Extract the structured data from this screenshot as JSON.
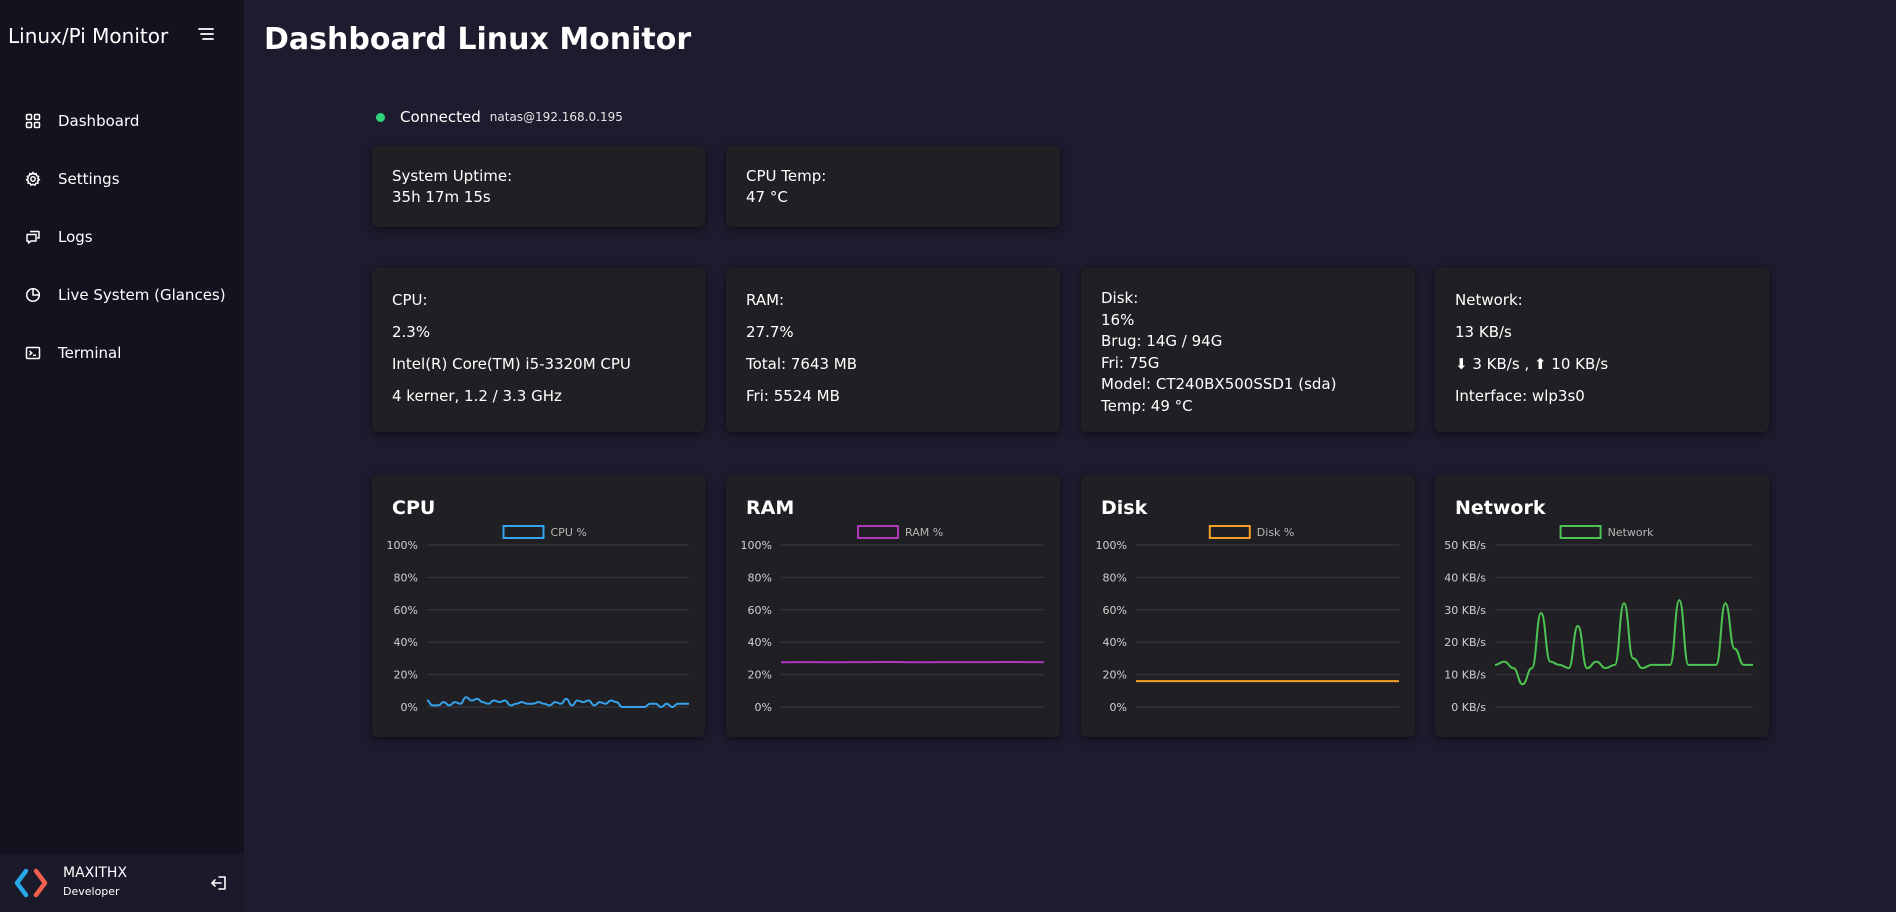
{
  "sidebar": {
    "brand": "Linux/Pi Monitor",
    "items": [
      {
        "label": "Dashboard",
        "icon": "grid-icon"
      },
      {
        "label": "Settings",
        "icon": "gear-icon"
      },
      {
        "label": "Logs",
        "icon": "messages-icon"
      },
      {
        "label": "Live System (Glances)",
        "icon": "pie-icon"
      },
      {
        "label": "Terminal",
        "icon": "terminal-icon"
      }
    ],
    "profile": {
      "name": "MAXITHX",
      "role": "Developer"
    }
  },
  "header": {
    "title": "Dashboard Linux Monitor"
  },
  "status": {
    "text": "Connected",
    "host": "natas@192.168.0.195",
    "color": "#2fd47a"
  },
  "uptime": {
    "label": "System Uptime:",
    "value": "35h 17m 15s"
  },
  "temp": {
    "label": "CPU Temp:",
    "value": "47 °C"
  },
  "cpu": {
    "label": "CPU:",
    "usage": "2.3%",
    "model": "Intel(R) Core(TM) i5-3320M CPU",
    "cores": "4 kerner, 1.2 / 3.3 GHz"
  },
  "ram": {
    "label": "RAM:",
    "usage": "27.7%",
    "total": "Total: 7643 MB",
    "free": "Fri: 5524 MB"
  },
  "disk": {
    "label": "Disk:",
    "usage": "16%",
    "used": "Brug: 14G / 94G",
    "free": "Fri: 75G",
    "model": "Model: CT240BX500SSD1 (sda)",
    "temp": "Temp: 49 °C"
  },
  "network": {
    "label": "Network:",
    "speed": "13 KB/s",
    "updown": "⬇ 3 KB/s , ⬆ 10 KB/s",
    "interface": "Interface: wlp3s0"
  },
  "chart_data": [
    {
      "type": "line",
      "title": "CPU",
      "legend": "CPU %",
      "color": "#36a2eb",
      "yticks": [
        "100%",
        "80%",
        "60%",
        "40%",
        "20%",
        "0%"
      ],
      "ylim": [
        0,
        100
      ],
      "values": [
        4,
        1,
        1,
        3,
        1,
        3,
        2,
        6,
        4,
        5,
        3,
        2,
        4,
        3,
        4,
        1,
        2,
        3,
        2,
        2,
        3,
        2,
        1,
        3,
        2,
        5,
        1,
        4,
        3,
        4,
        1,
        3,
        2,
        4,
        3,
        0,
        0,
        0,
        0,
        0,
        2,
        2,
        0,
        2,
        0,
        2,
        2,
        2
      ]
    },
    {
      "type": "line",
      "title": "RAM",
      "legend": "RAM %",
      "color": "#b037bf",
      "yticks": [
        "100%",
        "80%",
        "60%",
        "40%",
        "20%",
        "0%"
      ],
      "ylim": [
        0,
        100
      ],
      "values": [
        27.6,
        27.7,
        27.7,
        27.6,
        27.7,
        27.7,
        27.8,
        27.7,
        27.6,
        27.7,
        27.7,
        27.7,
        27.7,
        27.8,
        27.7,
        27.7
      ]
    },
    {
      "type": "line",
      "title": "Disk",
      "legend": "Disk %",
      "color": "#f5a020",
      "yticks": [
        "100%",
        "80%",
        "60%",
        "40%",
        "20%",
        "0%"
      ],
      "ylim": [
        0,
        100
      ],
      "values": [
        16,
        16,
        16,
        16,
        16,
        16,
        16,
        16,
        16,
        16,
        16,
        16,
        16,
        16,
        16,
        16
      ]
    },
    {
      "type": "line",
      "title": "Network",
      "legend": "Network",
      "color": "#4cc250",
      "yticks": [
        "50 KB/s",
        "40 KB/s",
        "30 KB/s",
        "20 KB/s",
        "10 KB/s",
        "0 KB/s"
      ],
      "ylim": [
        0,
        50
      ],
      "values": [
        13,
        14,
        12,
        7,
        12,
        29,
        14,
        13,
        12,
        25,
        12,
        14,
        12,
        13,
        32,
        15,
        12,
        13,
        13,
        13,
        33,
        13,
        13,
        13,
        13,
        32,
        18,
        13,
        13
      ]
    }
  ]
}
